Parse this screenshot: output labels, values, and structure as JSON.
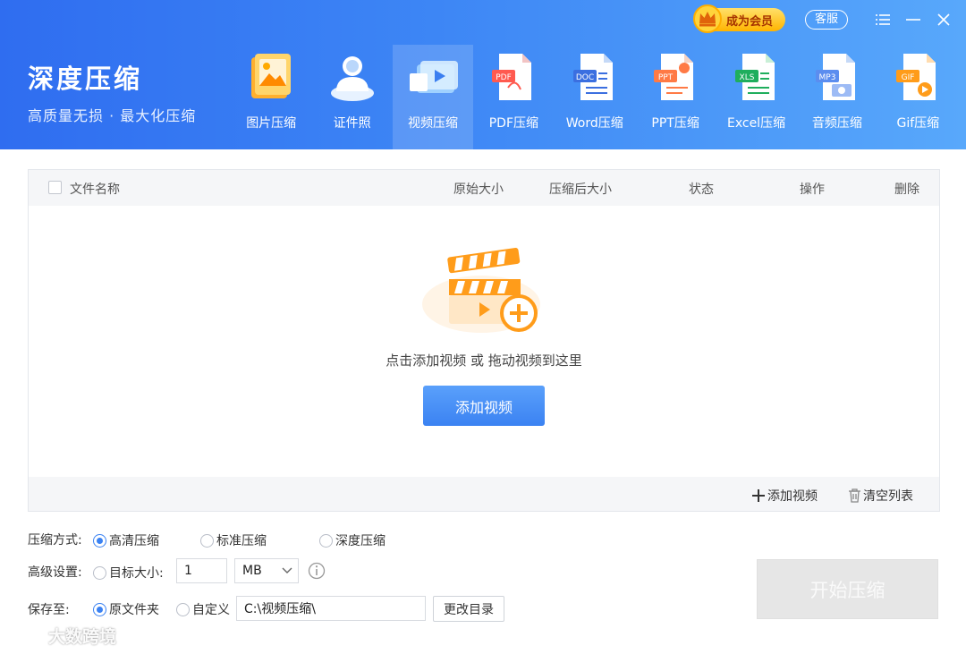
{
  "app": {
    "title": "深度压缩",
    "subtitle": "高质量无损 · 最大化压缩"
  },
  "topbar": {
    "vip_label": "成为会员",
    "service_label": "客服"
  },
  "tools": [
    {
      "label": "图片压缩",
      "icon": "image-compress-icon"
    },
    {
      "label": "证件照",
      "icon": "id-photo-icon"
    },
    {
      "label": "视频压缩",
      "icon": "video-compress-icon",
      "active": true
    },
    {
      "label": "PDF压缩",
      "icon": "pdf-icon"
    },
    {
      "label": "Word压缩",
      "icon": "word-icon"
    },
    {
      "label": "PPT压缩",
      "icon": "ppt-icon"
    },
    {
      "label": "Excel压缩",
      "icon": "excel-icon"
    },
    {
      "label": "音频压缩",
      "icon": "audio-icon"
    },
    {
      "label": "Gif压缩",
      "icon": "gif-icon"
    }
  ],
  "file_icon_tags": {
    "pdf": "PDF",
    "word": "DOC",
    "ppt": "PPT",
    "excel": "XLS",
    "audio": "MP3",
    "gif": "GIF"
  },
  "table": {
    "columns": [
      "文件名称",
      "原始大小",
      "压缩后大小",
      "状态",
      "操作",
      "删除"
    ],
    "drop_hint": "点击添加视频 或 拖动视频到这里",
    "add_button": "添加视频",
    "footer_add": "添加视频",
    "footer_clear": "清空列表"
  },
  "settings": {
    "mode_label": "压缩方式:",
    "modes": [
      "高清压缩",
      "标准压缩",
      "深度压缩"
    ],
    "advanced_label": "高级设置:",
    "target_size_label": "目标大小:",
    "target_size_value": "1",
    "unit_value": "MB",
    "save_label": "保存至:",
    "save_original": "原文件夹",
    "save_custom": "自定义",
    "path_value": "C:\\视频压缩\\",
    "change_dir": "更改目录"
  },
  "start_button": "开始压缩",
  "watermark": "大数跨境",
  "colors": {
    "header_start": "#2f6df0",
    "header_end": "#58a8fb",
    "accent": "#3b82f2",
    "vip_gold": "#ffb400",
    "video_orange": "#ff9c1a"
  }
}
